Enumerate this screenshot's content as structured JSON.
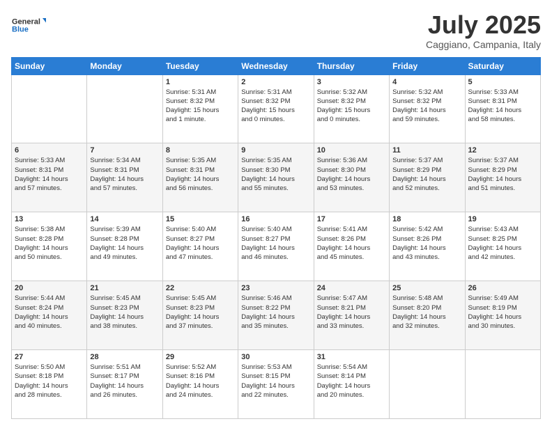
{
  "header": {
    "logo_line1": "General",
    "logo_line2": "Blue",
    "month": "July 2025",
    "location": "Caggiano, Campania, Italy"
  },
  "weekdays": [
    "Sunday",
    "Monday",
    "Tuesday",
    "Wednesday",
    "Thursday",
    "Friday",
    "Saturday"
  ],
  "weeks": [
    [
      {
        "day": "",
        "info": ""
      },
      {
        "day": "",
        "info": ""
      },
      {
        "day": "1",
        "info": "Sunrise: 5:31 AM\nSunset: 8:32 PM\nDaylight: 15 hours\nand 1 minute."
      },
      {
        "day": "2",
        "info": "Sunrise: 5:31 AM\nSunset: 8:32 PM\nDaylight: 15 hours\nand 0 minutes."
      },
      {
        "day": "3",
        "info": "Sunrise: 5:32 AM\nSunset: 8:32 PM\nDaylight: 15 hours\nand 0 minutes."
      },
      {
        "day": "4",
        "info": "Sunrise: 5:32 AM\nSunset: 8:32 PM\nDaylight: 14 hours\nand 59 minutes."
      },
      {
        "day": "5",
        "info": "Sunrise: 5:33 AM\nSunset: 8:31 PM\nDaylight: 14 hours\nand 58 minutes."
      }
    ],
    [
      {
        "day": "6",
        "info": "Sunrise: 5:33 AM\nSunset: 8:31 PM\nDaylight: 14 hours\nand 57 minutes."
      },
      {
        "day": "7",
        "info": "Sunrise: 5:34 AM\nSunset: 8:31 PM\nDaylight: 14 hours\nand 57 minutes."
      },
      {
        "day": "8",
        "info": "Sunrise: 5:35 AM\nSunset: 8:31 PM\nDaylight: 14 hours\nand 56 minutes."
      },
      {
        "day": "9",
        "info": "Sunrise: 5:35 AM\nSunset: 8:30 PM\nDaylight: 14 hours\nand 55 minutes."
      },
      {
        "day": "10",
        "info": "Sunrise: 5:36 AM\nSunset: 8:30 PM\nDaylight: 14 hours\nand 53 minutes."
      },
      {
        "day": "11",
        "info": "Sunrise: 5:37 AM\nSunset: 8:29 PM\nDaylight: 14 hours\nand 52 minutes."
      },
      {
        "day": "12",
        "info": "Sunrise: 5:37 AM\nSunset: 8:29 PM\nDaylight: 14 hours\nand 51 minutes."
      }
    ],
    [
      {
        "day": "13",
        "info": "Sunrise: 5:38 AM\nSunset: 8:28 PM\nDaylight: 14 hours\nand 50 minutes."
      },
      {
        "day": "14",
        "info": "Sunrise: 5:39 AM\nSunset: 8:28 PM\nDaylight: 14 hours\nand 49 minutes."
      },
      {
        "day": "15",
        "info": "Sunrise: 5:40 AM\nSunset: 8:27 PM\nDaylight: 14 hours\nand 47 minutes."
      },
      {
        "day": "16",
        "info": "Sunrise: 5:40 AM\nSunset: 8:27 PM\nDaylight: 14 hours\nand 46 minutes."
      },
      {
        "day": "17",
        "info": "Sunrise: 5:41 AM\nSunset: 8:26 PM\nDaylight: 14 hours\nand 45 minutes."
      },
      {
        "day": "18",
        "info": "Sunrise: 5:42 AM\nSunset: 8:26 PM\nDaylight: 14 hours\nand 43 minutes."
      },
      {
        "day": "19",
        "info": "Sunrise: 5:43 AM\nSunset: 8:25 PM\nDaylight: 14 hours\nand 42 minutes."
      }
    ],
    [
      {
        "day": "20",
        "info": "Sunrise: 5:44 AM\nSunset: 8:24 PM\nDaylight: 14 hours\nand 40 minutes."
      },
      {
        "day": "21",
        "info": "Sunrise: 5:45 AM\nSunset: 8:23 PM\nDaylight: 14 hours\nand 38 minutes."
      },
      {
        "day": "22",
        "info": "Sunrise: 5:45 AM\nSunset: 8:23 PM\nDaylight: 14 hours\nand 37 minutes."
      },
      {
        "day": "23",
        "info": "Sunrise: 5:46 AM\nSunset: 8:22 PM\nDaylight: 14 hours\nand 35 minutes."
      },
      {
        "day": "24",
        "info": "Sunrise: 5:47 AM\nSunset: 8:21 PM\nDaylight: 14 hours\nand 33 minutes."
      },
      {
        "day": "25",
        "info": "Sunrise: 5:48 AM\nSunset: 8:20 PM\nDaylight: 14 hours\nand 32 minutes."
      },
      {
        "day": "26",
        "info": "Sunrise: 5:49 AM\nSunset: 8:19 PM\nDaylight: 14 hours\nand 30 minutes."
      }
    ],
    [
      {
        "day": "27",
        "info": "Sunrise: 5:50 AM\nSunset: 8:18 PM\nDaylight: 14 hours\nand 28 minutes."
      },
      {
        "day": "28",
        "info": "Sunrise: 5:51 AM\nSunset: 8:17 PM\nDaylight: 14 hours\nand 26 minutes."
      },
      {
        "day": "29",
        "info": "Sunrise: 5:52 AM\nSunset: 8:16 PM\nDaylight: 14 hours\nand 24 minutes."
      },
      {
        "day": "30",
        "info": "Sunrise: 5:53 AM\nSunset: 8:15 PM\nDaylight: 14 hours\nand 22 minutes."
      },
      {
        "day": "31",
        "info": "Sunrise: 5:54 AM\nSunset: 8:14 PM\nDaylight: 14 hours\nand 20 minutes."
      },
      {
        "day": "",
        "info": ""
      },
      {
        "day": "",
        "info": ""
      }
    ]
  ]
}
